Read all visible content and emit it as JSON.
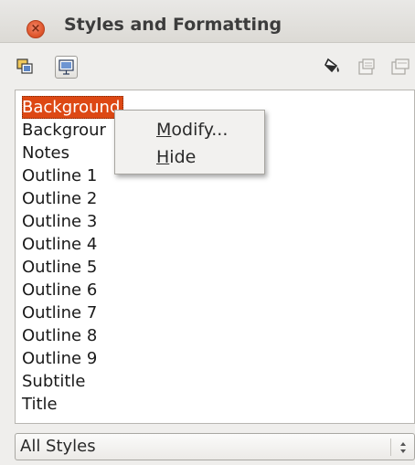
{
  "window": {
    "title": "Styles and Formatting",
    "close_glyph": "×"
  },
  "toolbar": {
    "buttons": [
      {
        "name": "drawing-styles-icon",
        "pressed": false
      },
      {
        "name": "presentation-styles-icon",
        "pressed": true
      },
      {
        "name": "fill-format-mode-icon",
        "pressed": false
      },
      {
        "name": "new-style-from-selection-icon",
        "pressed": false
      },
      {
        "name": "update-style-icon",
        "pressed": false
      }
    ]
  },
  "styles_list": {
    "items": [
      {
        "label": "Background",
        "selected": true
      },
      {
        "label": "Backgrour",
        "selected": false
      },
      {
        "label": "Notes",
        "selected": false
      },
      {
        "label": "Outline 1",
        "selected": false
      },
      {
        "label": "Outline 2",
        "selected": false
      },
      {
        "label": "Outline 3",
        "selected": false
      },
      {
        "label": "Outline 4",
        "selected": false
      },
      {
        "label": "Outline 5",
        "selected": false
      },
      {
        "label": "Outline 6",
        "selected": false
      },
      {
        "label": "Outline 7",
        "selected": false
      },
      {
        "label": "Outline 8",
        "selected": false
      },
      {
        "label": "Outline 9",
        "selected": false
      },
      {
        "label": "Subtitle",
        "selected": false
      },
      {
        "label": "Title",
        "selected": false
      }
    ]
  },
  "context_menu": {
    "items": [
      {
        "mnemonic": "M",
        "rest": "odify..."
      },
      {
        "mnemonic": "H",
        "rest": "ide"
      }
    ]
  },
  "filter_dropdown": {
    "value": "All Styles"
  },
  "colors": {
    "selection": "#dd4814",
    "close_button": "#e0582e"
  }
}
